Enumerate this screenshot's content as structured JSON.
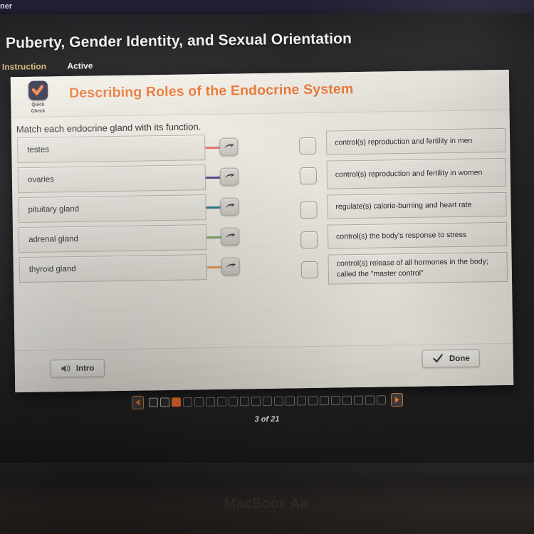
{
  "screen": {
    "top_strip_partial_text": "ner",
    "device_label": "MacBook Air"
  },
  "header": {
    "page_title": "Puberty, Gender Identity, and Sexual Orientation",
    "tabs": [
      {
        "label": "Instruction",
        "color": "#d9b97f"
      },
      {
        "label": "Active",
        "color": "#efefef"
      }
    ]
  },
  "card": {
    "badge": {
      "line1": "Quick",
      "line2": "Check",
      "icon": "check-icon",
      "color": "#ea7b3c"
    },
    "title": "Describing Roles of the Endocrine System",
    "title_color": "#ea7b3c",
    "prompt": "Match each endocrine gland with its function."
  },
  "match": {
    "left_items": [
      {
        "label": "testes",
        "connector_color": "#e4796e"
      },
      {
        "label": "ovaries",
        "connector_color": "#5b4a93"
      },
      {
        "label": "pituitary gland",
        "connector_color": "#2d7f8c"
      },
      {
        "label": "adrenal gland",
        "connector_color": "#7ea56a"
      },
      {
        "label": "thyroid gland",
        "connector_color": "#e79a4e"
      }
    ],
    "right_items": [
      {
        "text": "control(s) reproduction and fertility in men"
      },
      {
        "text": "control(s) reproduction and fertility in women"
      },
      {
        "text": "regulate(s) calorie-burning and heart rate"
      },
      {
        "text": "control(s) the body's response to stress"
      },
      {
        "text": "control(s) release of all hormones in the body; called the \"master control\""
      }
    ]
  },
  "footer": {
    "intro_label": "Intro",
    "intro_icon": "speaker-icon",
    "done_label": "Done",
    "done_icon": "checkmark-icon"
  },
  "pager": {
    "prev_icon": "triangle-left-icon",
    "next_icon": "triangle-right-icon",
    "total": 21,
    "current": 3,
    "count_label": "3 of 21",
    "current_color": "#ea6a2e"
  }
}
